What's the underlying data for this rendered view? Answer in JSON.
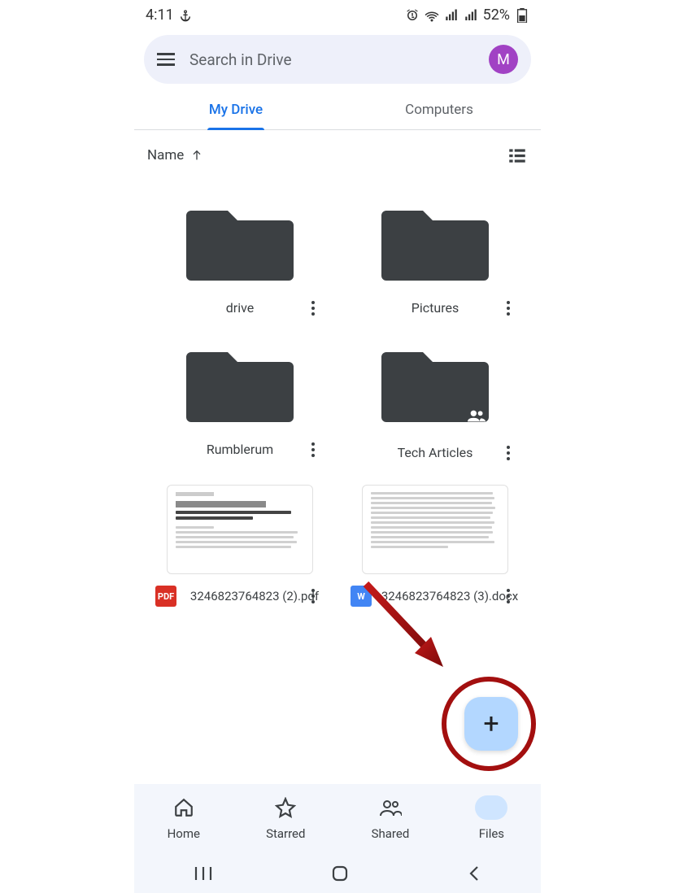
{
  "status": {
    "time": "4:11",
    "battery_pct": "52%"
  },
  "search": {
    "placeholder": "Search in Drive",
    "avatar_letter": "M"
  },
  "tabs": {
    "active": "My Drive",
    "inactive": "Computers"
  },
  "sort": {
    "label": "Name"
  },
  "items": [
    {
      "name": "drive",
      "type": "folder",
      "shared": false
    },
    {
      "name": "Pictures",
      "type": "folder",
      "shared": false
    },
    {
      "name": "Rumblerum",
      "type": "folder",
      "shared": false
    },
    {
      "name": "Tech Articles",
      "type": "folder",
      "shared": true
    },
    {
      "name": "3246823764823 (2).pdf",
      "type": "pdf"
    },
    {
      "name": "3246823764823 (3).docx",
      "type": "docx"
    }
  ],
  "nav": [
    {
      "label": "Home"
    },
    {
      "label": "Starred"
    },
    {
      "label": "Shared"
    },
    {
      "label": "Files"
    }
  ],
  "fab": {
    "symbol": "+"
  },
  "file_badges": {
    "pdf": "PDF",
    "docx": "W"
  }
}
